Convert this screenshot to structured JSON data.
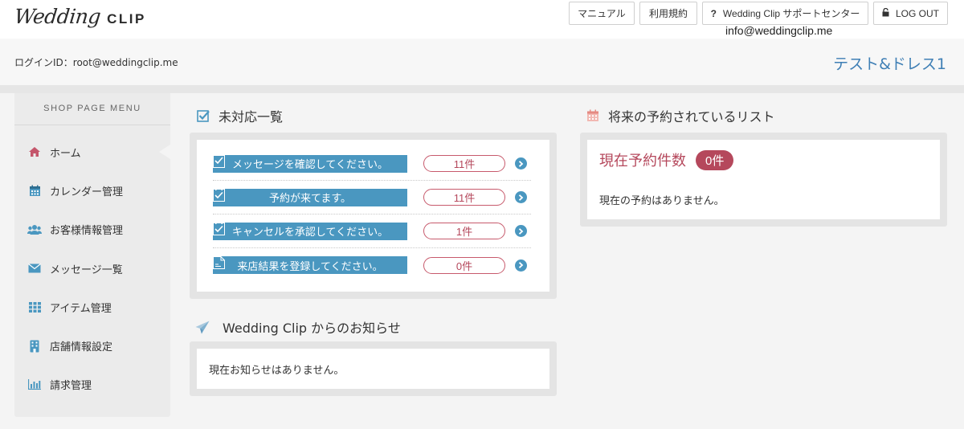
{
  "header": {
    "logo_script": "Wedding",
    "logo_clip": "CLIP",
    "manual_label": "マニュアル",
    "terms_label": "利用規約",
    "support_icon": "?",
    "support_label": "Wedding Clip サポートセンター",
    "support_email": "info@weddingclip.me",
    "logout_label": "LOG OUT"
  },
  "loginbar": {
    "login_id": "ログインID：root@weddingclip.me",
    "shop_name": "テスト&ドレス1"
  },
  "sidebar": {
    "title": "SHOP PAGE MENU",
    "items": [
      {
        "label": "ホーム",
        "icon": "home-icon"
      },
      {
        "label": "カレンダー管理",
        "icon": "calendar-icon"
      },
      {
        "label": "お客様情報管理",
        "icon": "users-icon"
      },
      {
        "label": "メッセージ一覧",
        "icon": "envelope-icon"
      },
      {
        "label": "アイテム管理",
        "icon": "grid-icon"
      },
      {
        "label": "店舗情報設定",
        "icon": "building-icon"
      },
      {
        "label": "請求管理",
        "icon": "bar-chart-icon"
      }
    ]
  },
  "pending": {
    "title": "未対応一覧",
    "tasks": [
      {
        "label": "メッセージを確認してください。",
        "count": "11件"
      },
      {
        "label": "予約が来てます。",
        "count": "11件"
      },
      {
        "label": "キャンセルを承認してください。",
        "count": "1件"
      },
      {
        "label": "来店結果を登録してください。",
        "count": "0件"
      }
    ]
  },
  "news": {
    "title": "Wedding Clip からのお知らせ",
    "empty": "現在お知らせはありません。"
  },
  "future": {
    "title": "将来の予約されているリスト",
    "count_title": "現在予約件数",
    "count_badge": "0件",
    "empty": "現在の予約はありません。"
  },
  "colors": {
    "accent_blue": "#4a97c0",
    "accent_rose": "#b5485c",
    "shop_name_blue": "#3f7fb5"
  }
}
